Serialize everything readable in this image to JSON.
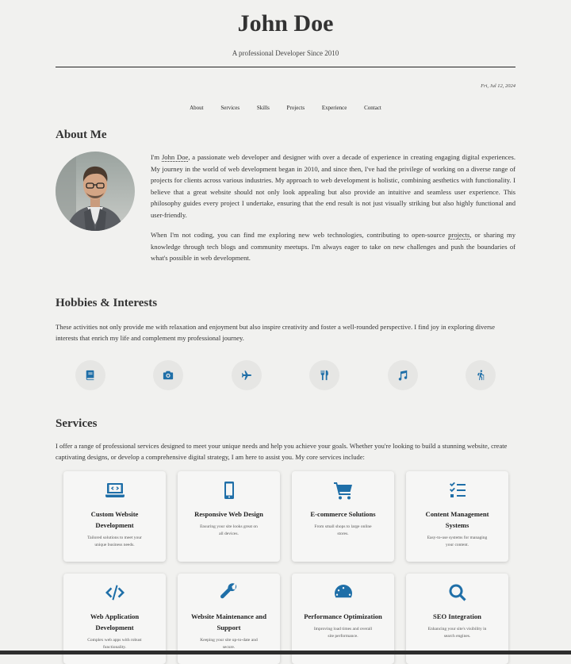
{
  "header": {
    "name": "John Doe",
    "tagline": "A professional Developer Since 2010",
    "date": "Fri, Jul 12, 2024"
  },
  "nav": [
    "About",
    "Services",
    "Skills",
    "Projects",
    "Experience",
    "Contact"
  ],
  "about": {
    "title": "About Me",
    "p1_before": "I'm ",
    "p1_link": "John Doe",
    "p1_after": ", a passionate web developer and designer with over a decade of experience in creating engaging digital experiences. My journey in the world of web development began in 2010, and since then, I've had the privilege of working on a diverse range of projects for clients across various industries. My approach to web development is holistic, combining aesthetics with functionality. I believe that a great website should not only look appealing but also provide an intuitive and seamless user experience. This philosophy guides every project I undertake, ensuring that the end result is not just visually striking but also highly functional and user-friendly.",
    "p2_before": "When I'm not coding, you can find me exploring new web technologies, contributing to open-source ",
    "p2_link": "projects",
    "p2_after": ", or sharing my knowledge through tech blogs and community meetups. I'm always eager to take on new challenges and push the boundaries of what's possible in web development."
  },
  "hobbies": {
    "title": "Hobbies & Interests",
    "text": "These activities not only provide me with relaxation and enjoyment but also inspire creativity and foster a well-rounded perspective. I find joy in exploring diverse interests that enrich my life and complement my professional journey.",
    "icons": [
      "book-icon",
      "camera-icon",
      "plane-icon",
      "utensils-icon",
      "music-icon",
      "hiking-icon"
    ]
  },
  "services": {
    "title": "Services",
    "text": "I offer a range of professional services designed to meet your unique needs and help you achieve your goals. Whether you're looking to build a stunning website, create captivating designs, or develop a comprehensive digital strategy, I am here to assist you. My core services include:",
    "items": [
      {
        "icon": "laptop-code-icon",
        "title": "Custom Website Development",
        "desc": "Tailored solutions to meet your unique business needs."
      },
      {
        "icon": "mobile-icon",
        "title": "Responsive Web Design",
        "desc": "Ensuring your site looks great on all devices."
      },
      {
        "icon": "cart-icon",
        "title": "E-commerce Solutions",
        "desc": "From small shops to large online stores."
      },
      {
        "icon": "list-check-icon",
        "title": "Content Management Systems",
        "desc": "Easy-to-use systems for managing your content."
      },
      {
        "icon": "code-icon",
        "title": "Web Application Development",
        "desc": "Complex web apps with robust functionality."
      },
      {
        "icon": "wrench-icon",
        "title": "Website Maintenance and Support",
        "desc": "Keeping your site up-to-date and secure."
      },
      {
        "icon": "gauge-icon",
        "title": "Performance Optimization",
        "desc": "Improving load times and overall site performance."
      },
      {
        "icon": "search-icon",
        "title": "SEO Integration",
        "desc": "Enhancing your site's visibility in search engines."
      }
    ]
  },
  "colors": {
    "accent": "#1f6fa8",
    "background": "#f1f1ef",
    "footer": "#2d2d2d"
  }
}
